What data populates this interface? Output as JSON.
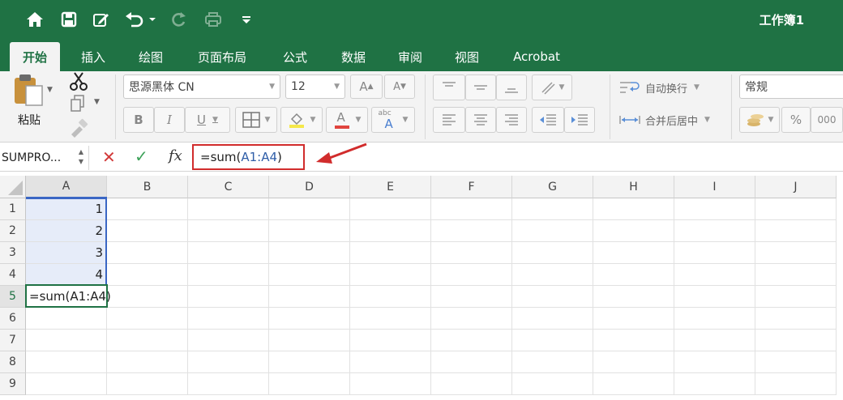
{
  "title_bar": {
    "document_title": "工作簿1",
    "quick_access": [
      {
        "icon": "home-icon"
      },
      {
        "icon": "save-icon"
      },
      {
        "icon": "edit-icon"
      },
      {
        "icon": "undo-icon"
      },
      {
        "icon": "redo-icon"
      },
      {
        "icon": "print-icon"
      },
      {
        "icon": "customize-dropdown-icon"
      }
    ],
    "colors": {
      "brand": "#1f7244",
      "ribbon": "#f3f3f3"
    }
  },
  "tabs": [
    {
      "label": "开始",
      "active": true
    },
    {
      "label": "插入"
    },
    {
      "label": "绘图"
    },
    {
      "label": "页面布局"
    },
    {
      "label": "公式"
    },
    {
      "label": "数据"
    },
    {
      "label": "审阅"
    },
    {
      "label": "视图"
    },
    {
      "label": "Acrobat"
    }
  ],
  "ribbon": {
    "paste_label": "粘贴",
    "font_name": "思源黑体 CN",
    "font_size": "12",
    "bold": "B",
    "italic": "I",
    "underline": "U",
    "font_color_letter": "A",
    "abc_label": "abc",
    "wrap_text_label": "自动换行",
    "merge_center_label": "合并后居中",
    "number_format": "常规",
    "percent": "%",
    "thousands": "000"
  },
  "formula_bar": {
    "name_box": "SUMPRO...",
    "cancel_symbol": "✕",
    "enter_symbol": "✓",
    "fx_label": "fx",
    "formula_prefix": "=sum(",
    "formula_ref": "A1:A4",
    "formula_suffix": ")"
  },
  "grid": {
    "columns": [
      "A",
      "B",
      "C",
      "D",
      "E",
      "F",
      "G",
      "H",
      "I",
      "J"
    ],
    "rows": [
      "1",
      "2",
      "3",
      "4",
      "5",
      "6",
      "7",
      "8",
      "9"
    ],
    "active_cell": "A5",
    "cells": {
      "A1": "1",
      "A2": "2",
      "A3": "3",
      "A4": "4",
      "A5": "=sum(A1:A4)"
    },
    "colors": {
      "selection_fill": "#e6ecf9",
      "selection_border": "#3a66c4",
      "active_border": "#1f7244",
      "annotation_red": "#d12c2c"
    }
  }
}
